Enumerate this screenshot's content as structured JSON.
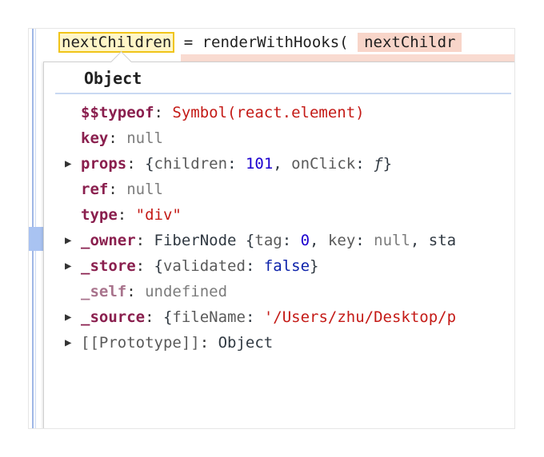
{
  "code": {
    "line1_var": "nextChildren",
    "line1_rest": " = renderWithHooks(",
    "line1_arg": "nextChildr"
  },
  "popover": {
    "title": "Object",
    "rows": [
      {
        "key": "$$typeof",
        "value": "Symbol(react.element)",
        "expandable": false
      },
      {
        "key": "key",
        "value": "null",
        "expandable": false
      },
      {
        "key": "props",
        "value_parts": [
          "{",
          "children",
          ": ",
          "101",
          ", ",
          "onClick",
          ": ",
          "ƒ",
          "}"
        ],
        "expandable": true
      },
      {
        "key": "ref",
        "value": "null",
        "expandable": false
      },
      {
        "key": "type",
        "value": "\"div\"",
        "expandable": false
      },
      {
        "key": "_owner",
        "value_parts": [
          "FiberNode {",
          "tag",
          ": ",
          "0",
          ", ",
          "key",
          ": ",
          "null",
          ", sta"
        ],
        "expandable": true
      },
      {
        "key": "_store",
        "value_parts": [
          "{",
          "validated",
          ": ",
          "false",
          "}"
        ],
        "expandable": true
      },
      {
        "key": "_self",
        "value": "undefined",
        "expandable": false
      },
      {
        "key": "_source",
        "value_parts": [
          "{",
          "fileName",
          ": ",
          "'/Users/zhu/Desktop/p"
        ],
        "expandable": true
      },
      {
        "key": "[[Prototype]]",
        "value": "Object",
        "expandable": true
      }
    ]
  },
  "icons": {
    "expand": "▶"
  },
  "colors": {
    "key": "#8a1f4e",
    "string": "#c41a16",
    "number": "#1c00cf",
    "null": "#7c7c7c",
    "highlight_border": "#f0c419",
    "arg_bg": "#f8d5c9"
  }
}
